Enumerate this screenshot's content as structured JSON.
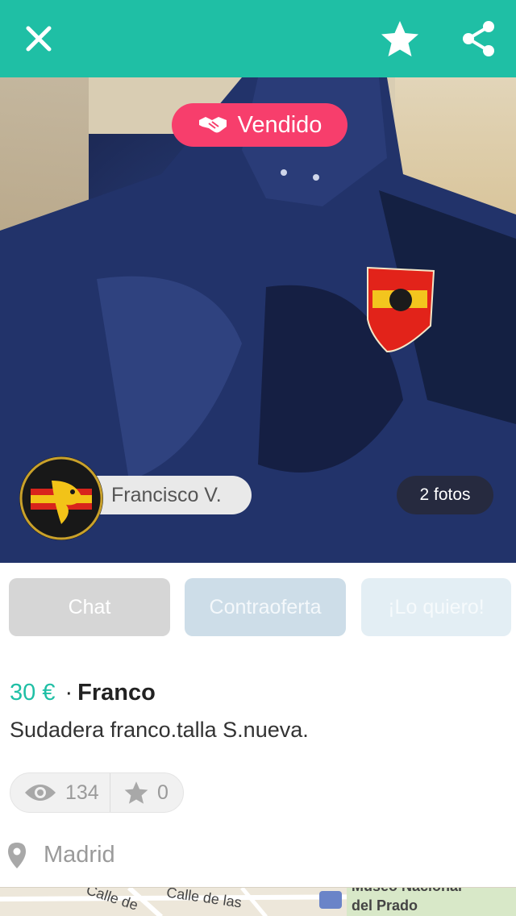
{
  "header": {
    "close_icon": "close-icon",
    "favorite_icon": "star-icon",
    "share_icon": "share-icon",
    "bar_color": "#1fbfa5"
  },
  "photo": {
    "status_badge": "Vendido",
    "status_icon": "handshake-icon",
    "status_color": "#f73e6c",
    "seller_name": "Francisco V.",
    "photo_count": "2 fotos"
  },
  "actions": {
    "chat": "Chat",
    "counteroffer": "Contraoferta",
    "want": "¡Lo quiero!"
  },
  "listing": {
    "price": "30 €",
    "separator": "·",
    "brand": "Franco",
    "description": "Sudadera franco.talla S.nueva.",
    "views": "134",
    "favorites": "0",
    "location": "Madrid"
  },
  "map": {
    "street1": "Calle de",
    "street2": "Calle de las",
    "poi": "Museo Nacional",
    "poi2": "del Prado"
  }
}
